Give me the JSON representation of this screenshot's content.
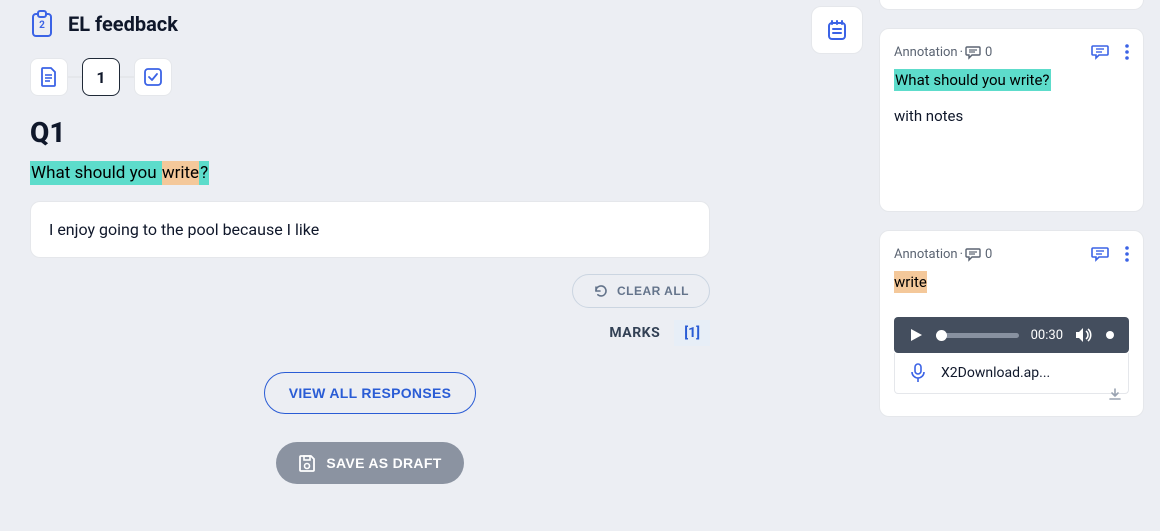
{
  "header": {
    "title": "EL feedback",
    "clipboard_badge": "2"
  },
  "steps": {
    "current": "1"
  },
  "question": {
    "label": "Q1",
    "prompt_teal_pre": "What should you ",
    "prompt_orange": "write",
    "prompt_teal_post": "?"
  },
  "answer": {
    "text": "I enjoy going to the pool because I like"
  },
  "controls": {
    "clear_label": "CLEAR ALL",
    "marks_label": "MARKS",
    "marks_value": "[1]",
    "view_label": "VIEW ALL RESPONSES",
    "save_label": "SAVE AS DRAFT"
  },
  "annotations": [
    {
      "type_label": "Annotation",
      "dot": " · ",
      "count": "0",
      "highlight_style": "teal",
      "highlight_text": "What should you write?",
      "body": "with notes"
    },
    {
      "type_label": "Annotation",
      "dot": " · ",
      "count": "0",
      "highlight_style": "orange",
      "highlight_text": "write",
      "audio": {
        "time": "00:30",
        "filename": "X2Download.ap..."
      }
    }
  ]
}
